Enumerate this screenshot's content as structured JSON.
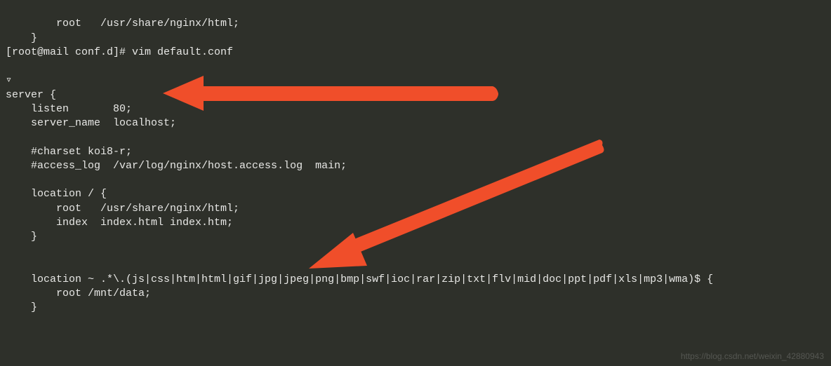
{
  "terminal": {
    "lines": [
      "        root   /usr/share/nginx/html;",
      "    }",
      "[root@mail conf.d]# vim default.conf",
      "",
      "▿",
      "server {",
      "    listen       80;",
      "    server_name  localhost;",
      "",
      "    #charset koi8-r;",
      "    #access_log  /var/log/nginx/host.access.log  main;",
      "",
      "    location / {",
      "        root   /usr/share/nginx/html;",
      "        index  index.html index.htm;",
      "    }",
      "",
      "",
      "    location ~ .*\\.(js|css|htm|html|gif|jpg|jpeg|png|bmp|swf|ioc|rar|zip|txt|flv|mid|doc|ppt|pdf|xls|mp3|wma)$ {",
      "        root /mnt/data;",
      "    }"
    ]
  },
  "annotations": {
    "arrow1": {
      "color": "#f04e2a",
      "points_to": "listen 80"
    },
    "arrow2": {
      "color": "#f04e2a",
      "points_to": "location static files block"
    }
  },
  "watermark": {
    "text": "https://blog.csdn.net/weixin_42880943"
  }
}
